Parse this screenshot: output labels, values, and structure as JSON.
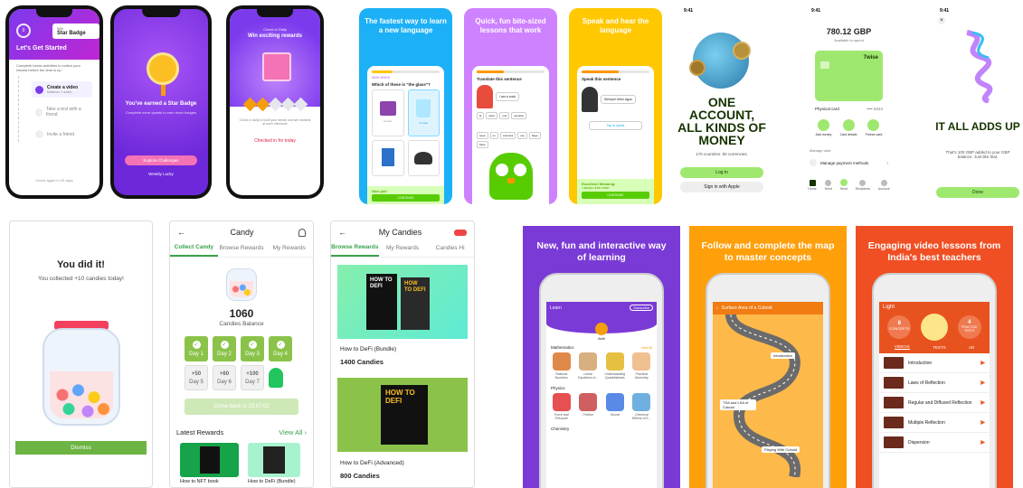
{
  "quest": {
    "s1": {
      "badge_small": "Win",
      "badge_title": "Star Badge",
      "heading": "Let's Get Started",
      "intro": "Complete below activities to collect your reward before the time is up.",
      "tasks": [
        "Create a video",
        "Take a test with a friend",
        "Invite a friend"
      ],
      "task_sub": "Minimum 1 action",
      "footer": "Check again in 20 days"
    },
    "s2": {
      "msg": "You've earned a Star Badge",
      "sub": "Complete more quests to earn more badges",
      "btn": "Explore Challenges",
      "link": "Weekly Lucky"
    },
    "s3": {
      "small": "Check in Daily",
      "title": "Win exciting rewards",
      "desc": "Check in daily to build your streak and win rewards at each milestone",
      "status": "Checked in for today"
    }
  },
  "duo": {
    "p1": {
      "title": "The fastest way to learn a new language",
      "bar": "NEW WORD",
      "question": "Which of these is \"the glass\"?",
      "options": [
        "la taza",
        "el vaso"
      ],
      "check": "Nice job!",
      "continue": "CONTINUE"
    },
    "p2": {
      "title": "Quick, fun bite-sized lessons that work",
      "question": "Translate this sentence",
      "bubble": "I am a cook",
      "words": [
        "la",
        "autor",
        "una",
        "escuela",
        "sopa",
        "un",
        "cocinera",
        "soy",
        "hago",
        "bebe"
      ]
    },
    "p3": {
      "title": "Speak and hear the language",
      "question": "Speak this sentence",
      "bubble": "Siempre bebo agua",
      "mic": "Tap to speak",
      "result": "Excellent! Meaning:",
      "result_sub": "I always drink water",
      "continue": "CONTINUE"
    }
  },
  "wise": {
    "p1": {
      "headline": "ONE ACCOUNT, ALL KINDS OF MONEY",
      "sub": "170 countries. 50 currencies.",
      "login": "Log in",
      "apple": "Sign in with Apple"
    },
    "p2": {
      "balance": "780.12 GBP",
      "bal_label": "Available to spend",
      "brand": "7wise",
      "card_name": "Physical card",
      "card_num": "•••• 5324",
      "actions": [
        "Add money",
        "Card details",
        "Freeze card"
      ],
      "manage": "Manage card",
      "manage_item": "Manage payment methods",
      "nav": [
        "Home",
        "Send",
        "Send",
        "Recipients",
        "Account"
      ]
    },
    "p3": {
      "headline": "IT ALL ADDS UP",
      "sub": "That's 100 GBP added to your GBP balance. Just like that.",
      "btn": "Done"
    }
  },
  "candy1": {
    "title": "You did it!",
    "sub": "You collected +10 candies today!",
    "btn": "Dismiss"
  },
  "candy2": {
    "back": "←",
    "title": "Candy",
    "tabs": [
      "Collect Candy",
      "Browse Rewards",
      "My Rewards"
    ],
    "balance": "1060",
    "balance_label": "Candies Balance",
    "days_done": [
      "Day 1",
      "Day 2",
      "Day 3",
      "Day 4"
    ],
    "days_todo": [
      {
        "v": "+50",
        "d": "Day 5"
      },
      {
        "v": "+60",
        "d": "Day 6"
      },
      {
        "v": "+100",
        "d": "Day 7"
      }
    ],
    "comeback": "Come back in 23:57:02",
    "latest": "Latest Rewards",
    "view_all": "View All ›",
    "rewards": [
      "How to NFT book",
      "How to DeFi (Bundle)"
    ]
  },
  "candy3": {
    "back": "←",
    "title": "My Candies",
    "tabs": [
      "Browse Rewards",
      "My Rewards",
      "Candies Hi"
    ],
    "items": [
      {
        "name": "How to DeFi (Bundle)",
        "price": "1400 Candies",
        "b1": "HOW TO DEFI",
        "b2": "HOW TO DEFI"
      },
      {
        "name": "How to DeFi (Advanced)",
        "price": "800 Candies",
        "b1": "HOW TO DEFI"
      }
    ]
  },
  "edu": {
    "p1": {
      "title": "New, fun and interactive way of learning",
      "app_title": "Learn",
      "subscribe": "Subscribe",
      "user": "Abhi",
      "sections": [
        "Mathematics",
        "Physics",
        "Chemistry"
      ],
      "view_all": "View All",
      "math": [
        "Rational Numbers",
        "Linear Equations in...",
        "Understanding Quadrilaterals",
        "Practical Geometry"
      ],
      "phys": [
        "Force and Pressure",
        "Friction",
        "Sound",
        "Chemical Effects of E..."
      ]
    },
    "p2": {
      "title": "Follow and complete the map to master concepts",
      "app_title": "Surface Area of a Cuboid",
      "nodes": [
        "Introduction",
        "TSA and LSA of Cuboid",
        "Playing With Cuboid"
      ]
    },
    "p3": {
      "title": "Engaging video lessons from India's best teachers",
      "app_title": "Light",
      "stats": [
        {
          "v": "8",
          "l": "CONCEPTS"
        },
        {
          "v": "4",
          "l": "PRACTICE TESTS"
        }
      ],
      "tabs": [
        "VIDEOS",
        "TESTS",
        "AD"
      ],
      "videos": [
        "Introduction",
        "Laws of Reflection",
        "Regular and Diffused Reflection",
        "Multiple Reflection",
        "Dispersion"
      ]
    }
  },
  "colors": {
    "purple": "#8a3ee6",
    "duo_blue": "#1cb0f6",
    "duo_purple": "#ce82ff",
    "duo_yellow": "#ffc800",
    "wise_green": "#9fe870",
    "candy_green": "#3aa24a",
    "edu_purple": "#7a3ad6",
    "edu_orange": "#ff9f0a",
    "edu_red": "#f04e23"
  }
}
